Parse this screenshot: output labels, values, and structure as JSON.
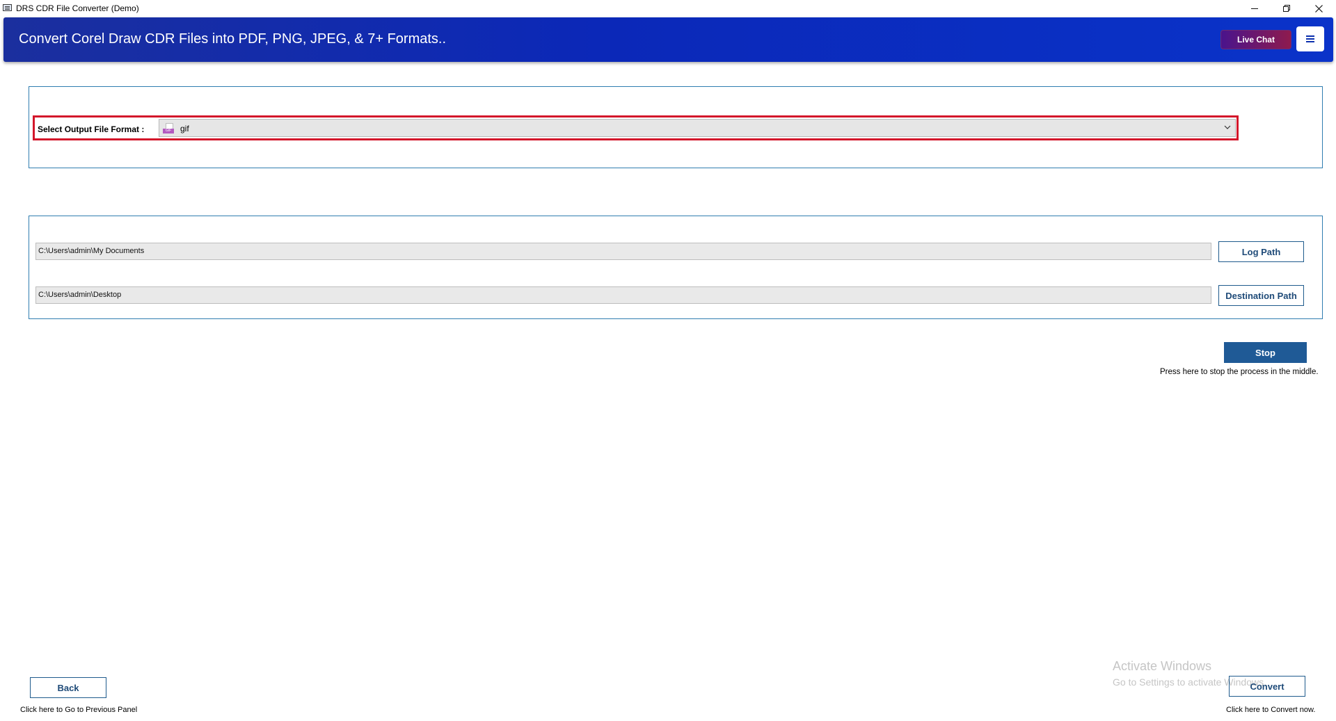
{
  "window": {
    "title": "DRS CDR File Converter (Demo)"
  },
  "header": {
    "title": "Convert Corel Draw CDR Files into PDF, PNG, JPEG, & 7+ Formats..",
    "live_chat_label": "Live Chat",
    "menu_icon": "hamburger-icon"
  },
  "format": {
    "label": "Select Output File Format :",
    "selected": "gif",
    "icon": "gif-file-icon"
  },
  "paths": {
    "log_path_value": "C:\\Users\\admin\\My Documents",
    "log_path_button": "Log Path",
    "destination_path_value": "C:\\Users\\admin\\Desktop",
    "destination_path_button": "Destination Path"
  },
  "stop": {
    "label": "Stop",
    "hint": "Press here to stop the process in the middle."
  },
  "footer": {
    "back_label": "Back",
    "back_hint": "Click here to Go to Previous Panel",
    "convert_label": "Convert",
    "convert_hint": "Click here to Convert now."
  },
  "watermark": {
    "title": "Activate Windows",
    "subtitle": "Go to Settings to activate Windows."
  },
  "colors": {
    "banner": "#0b28b8",
    "accent_border": "#2f7db0",
    "highlight_red": "#d3162a",
    "stop_button": "#1f5a96"
  }
}
